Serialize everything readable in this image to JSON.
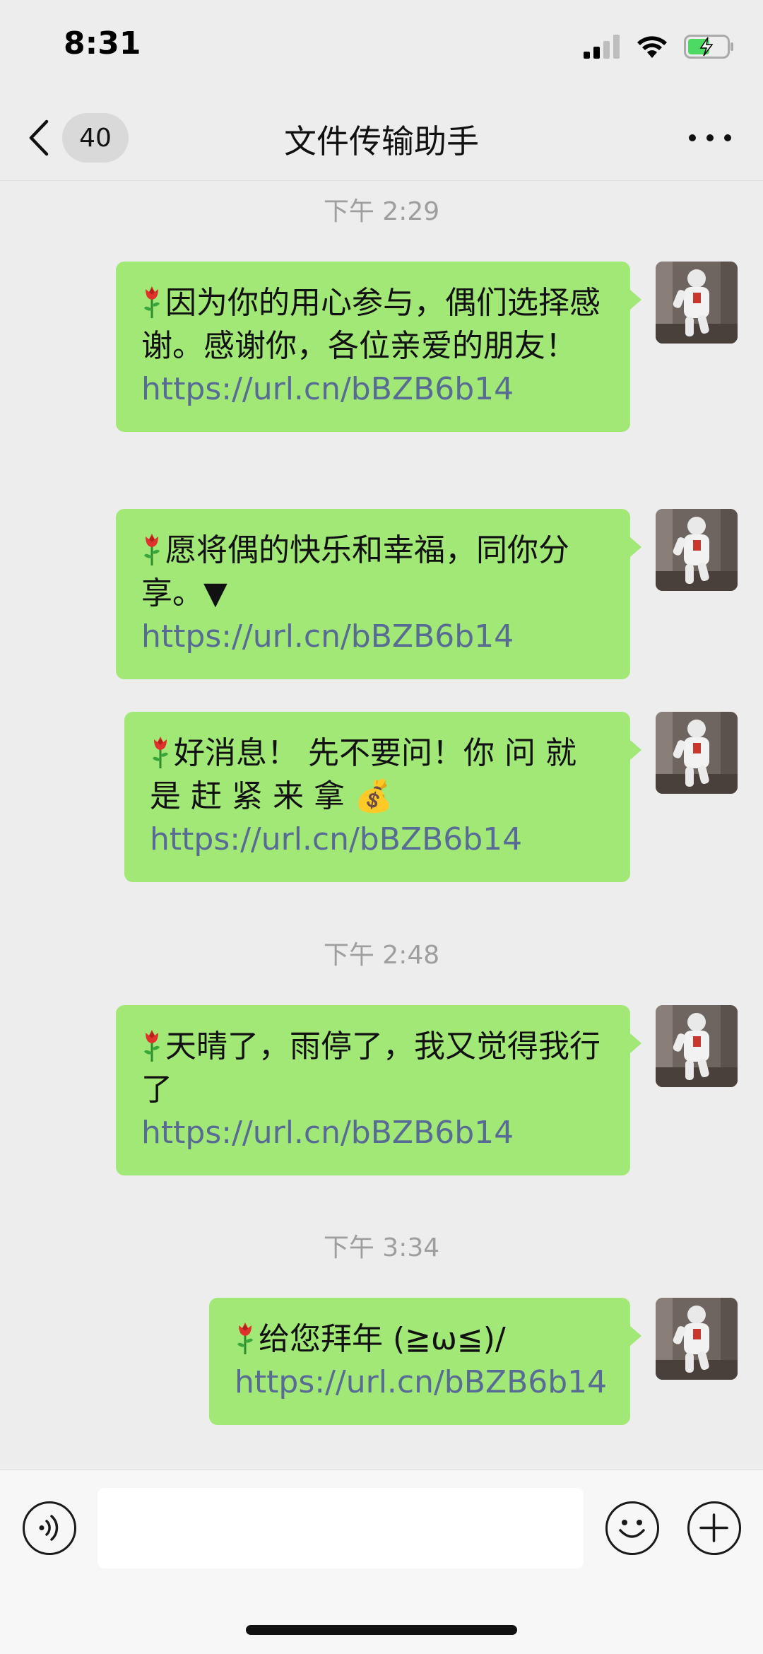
{
  "status_bar": {
    "time": "8:31"
  },
  "nav": {
    "unread_count": "40",
    "title": "文件传输助手"
  },
  "timestamps": [
    "下午 2:29",
    "下午 2:48",
    "下午 3:34"
  ],
  "messages": [
    {
      "text": "因为你的用心参与，偶们选择感谢。感谢你，各位亲爱的朋友！",
      "link": "https://url.cn/bBZB6b14"
    },
    {
      "text": "愿将偶的快乐和幸福，同你分享。▼",
      "link": "https://url.cn/bBZB6b14"
    },
    {
      "text": "好消息！ 先不要问！你 问 就 是 赶 紧 来 拿 💰",
      "link": "https://url.cn/bBZB6b14"
    },
    {
      "text": "天晴了，雨停了，我又觉得我行了",
      "link": "https://url.cn/bBZB6b14"
    },
    {
      "text": "给您拜年 (≧ω≦)/",
      "link": "https://url.cn/bBZB6b14"
    }
  ],
  "colors": {
    "bubble": "#a2e876",
    "link": "#576b95",
    "background": "#ededed"
  },
  "icons": [
    "rose-icon",
    "back-chevron-icon",
    "more-icon",
    "voice-icon",
    "emoji-icon",
    "plus-icon",
    "avatar"
  ]
}
